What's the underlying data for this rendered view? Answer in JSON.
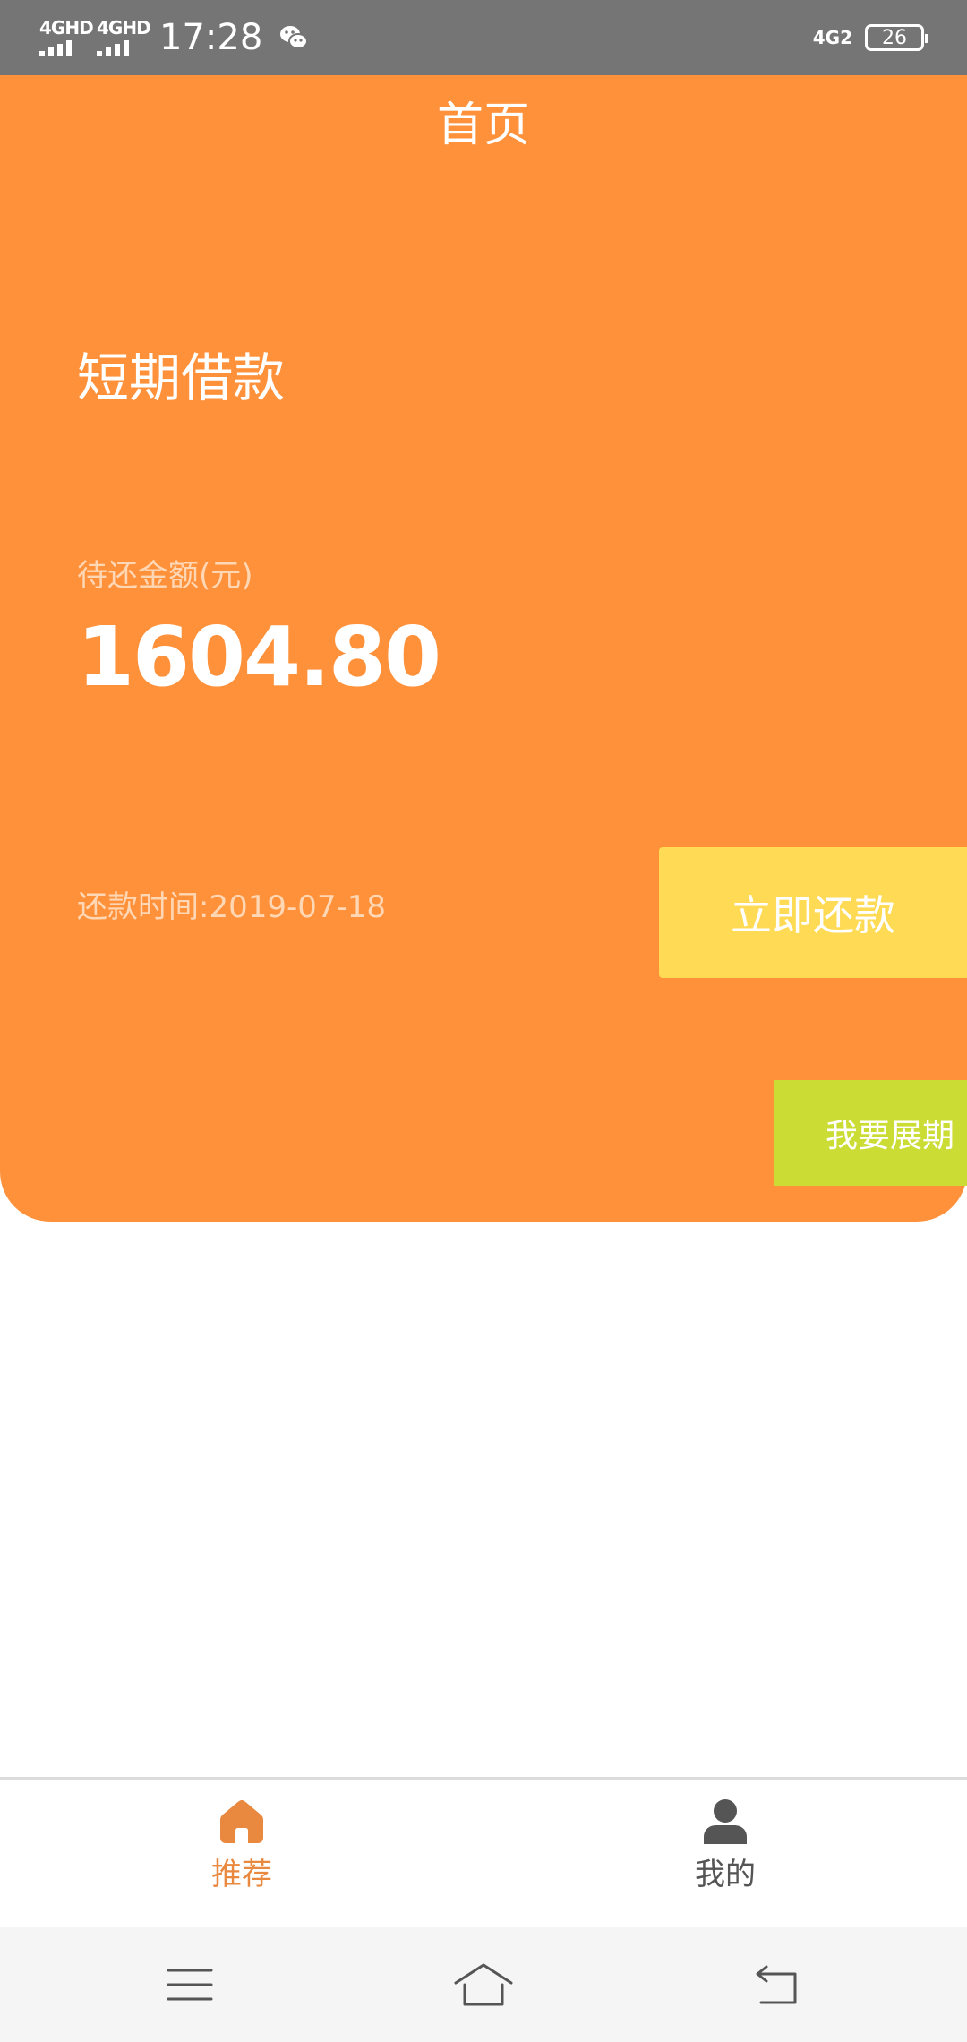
{
  "status_bar": {
    "signal_1": "4GHD",
    "signal_2": "4GHD",
    "time": "17:28",
    "network_right": "4G2",
    "battery": "26",
    "icons": [
      "signal-icon",
      "signal-icon",
      "wechat-icon",
      "network-icon",
      "battery-icon"
    ]
  },
  "header": {
    "title": "首页"
  },
  "loan": {
    "type": "短期借款",
    "amount_label": "待还金额(元)",
    "amount": "1604.80",
    "due_date": "还款时间:2019-07-18",
    "repay_button": "立即还款",
    "extend_button": "我要展期"
  },
  "tabs": [
    {
      "label": "推荐",
      "icon": "home-icon",
      "active": true
    },
    {
      "label": "我的",
      "icon": "person-icon",
      "active": false
    }
  ],
  "system_nav": {
    "icons": [
      "menu-icon",
      "home-outline-icon",
      "back-icon"
    ]
  },
  "colors": {
    "accent": "#FF913B",
    "repay_button": "#FFDA55",
    "extend_button": "#CBDC35",
    "active_tab": "#E9883F",
    "status_bar": "#757575"
  }
}
